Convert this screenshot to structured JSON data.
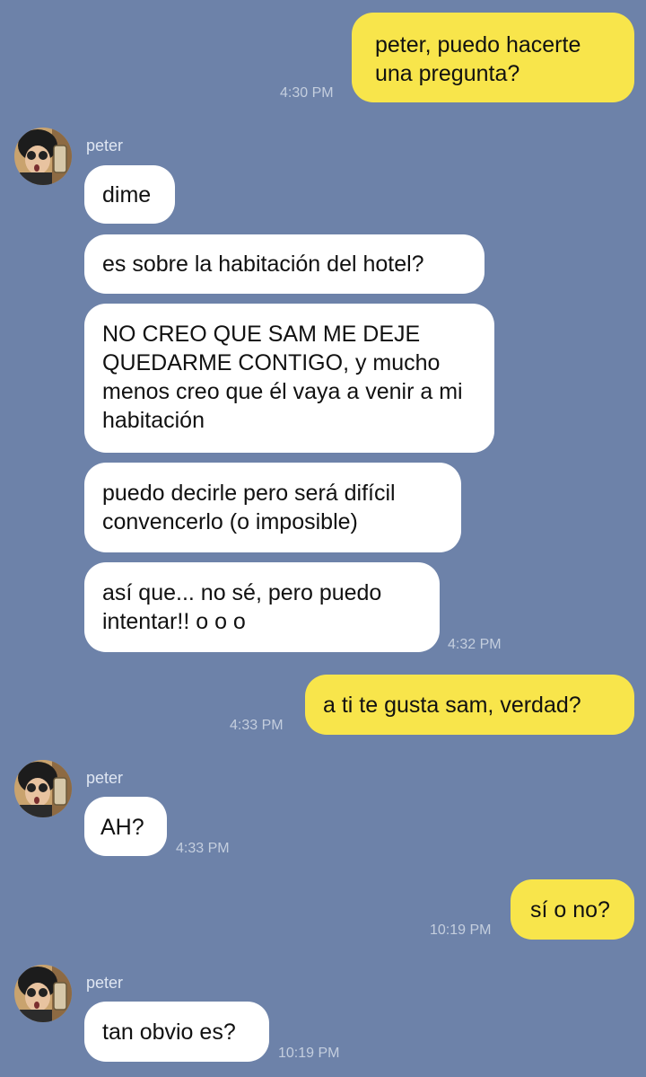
{
  "contact": {
    "name": "peter",
    "avatar_icon": "profile-photo-avatar-icon"
  },
  "colors": {
    "background": "#6d82a9",
    "outgoing_bubble": "#f8e54b",
    "incoming_bubble": "#ffffff",
    "timestamp": "#c4cede"
  },
  "messages": {
    "m1": {
      "text": "peter, puedo hacerte una pregunta?",
      "time": "4:30 PM"
    },
    "m2": {
      "text": "dime"
    },
    "m3": {
      "text": "es sobre la habitación del hotel?"
    },
    "m4": {
      "text": "NO CREO QUE SAM ME DEJE QUEDARME CONTIGO, y mucho menos creo que él vaya a venir a mi habitación"
    },
    "m5": {
      "text": "puedo decirle pero será difícil convencerlo (o imposible)"
    },
    "m6": {
      "text": "así que... no sé, pero puedo intentar!! o o o",
      "time": "4:32 PM"
    },
    "m7": {
      "text": "a ti te gusta sam, verdad?",
      "time": "4:33 PM"
    },
    "m8": {
      "text": "AH?",
      "time": "4:33 PM"
    },
    "m9": {
      "text": "sí o no?",
      "time": "10:19 PM"
    },
    "m10": {
      "text": "tan obvio es?",
      "time": "10:19 PM"
    }
  }
}
